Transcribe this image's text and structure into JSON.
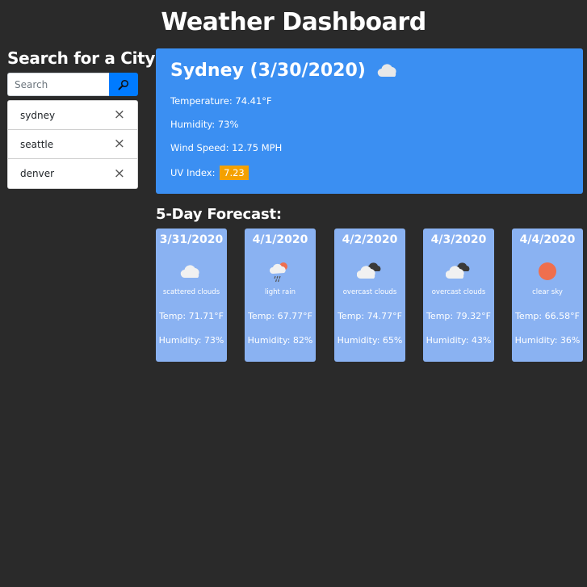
{
  "header": {
    "title": "Weather Dashboard"
  },
  "search": {
    "heading": "Search for a City",
    "placeholder": "Search",
    "button_icon": "search-icon"
  },
  "history": [
    {
      "city": "sydney"
    },
    {
      "city": "seattle"
    },
    {
      "city": "denver"
    }
  ],
  "current": {
    "title": "Sydney (3/30/2020)",
    "icon": "cloud-icon",
    "temperature": "Temperature: 74.41°F",
    "humidity": "Humidity: 73%",
    "wind": "Wind Speed: 12.75 MPH",
    "uv_label": "UV Index:",
    "uv_value": "7.23",
    "uv_color": "#f4a100",
    "panel_color": "#3b8ff2"
  },
  "forecast": {
    "heading": "5-Day Forecast:",
    "days": [
      {
        "date": "3/31/2020",
        "icon": "scattered-clouds-icon",
        "desc": "scattered clouds",
        "temp": "Temp: 71.71°F",
        "humidity": "Humidity: 73%"
      },
      {
        "date": "4/1/2020",
        "icon": "light-rain-icon",
        "desc": "light rain",
        "temp": "Temp: 67.77°F",
        "humidity": "Humidity: 82%"
      },
      {
        "date": "4/2/2020",
        "icon": "overcast-clouds-icon",
        "desc": "overcast clouds",
        "temp": "Temp: 74.77°F",
        "humidity": "Humidity: 65%"
      },
      {
        "date": "4/3/2020",
        "icon": "overcast-clouds-icon",
        "desc": "overcast clouds",
        "temp": "Temp: 79.32°F",
        "humidity": "Humidity: 43%"
      },
      {
        "date": "4/4/2020",
        "icon": "clear-sky-icon",
        "desc": "clear sky",
        "temp": "Temp: 66.58°F",
        "humidity": "Humidity: 36%"
      }
    ]
  }
}
